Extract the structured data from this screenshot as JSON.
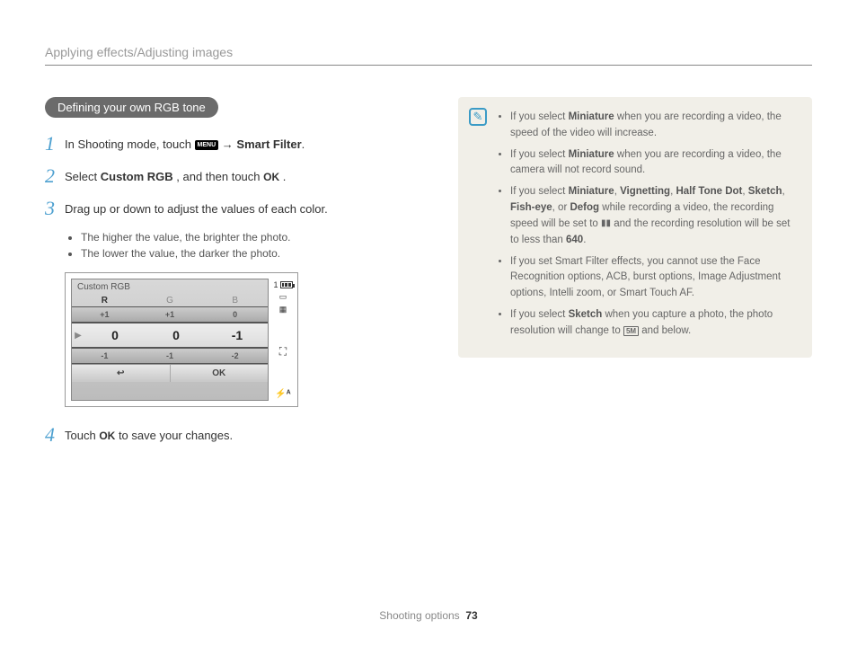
{
  "header": "Applying effects/Adjusting images",
  "pill": "Defining your own RGB tone",
  "steps": {
    "s1": {
      "num": "1",
      "pre": "In Shooting mode, touch ",
      "menu": "MENU",
      "arrow": " → ",
      "post": "Smart Filter",
      "end": "."
    },
    "s2": {
      "num": "2",
      "pre": "Select ",
      "cr": "Custom RGB",
      "mid": ", and then touch ",
      "ok": "OK",
      "end": " ."
    },
    "s3": {
      "num": "3",
      "text": "Drag up or down to adjust the values of each color."
    },
    "s3b": [
      "The higher the value, the brighter the photo.",
      "The lower the value, the darker the photo."
    ],
    "s4": {
      "num": "4",
      "pre": "Touch ",
      "ok": "OK",
      "post": " to save your changes."
    }
  },
  "rgb": {
    "title": "Custom RGB",
    "cols": [
      "R",
      "G",
      "B"
    ],
    "row_up": [
      "+1",
      "+1",
      "0"
    ],
    "row_mid": [
      "0",
      "0",
      "-1"
    ],
    "row_dn": [
      "-1",
      "-1",
      "-2"
    ],
    "back": "↩",
    "ok": "OK",
    "count": "1"
  },
  "notes": {
    "n1a": "If you select ",
    "n1b": "Miniature",
    "n1c": " when you are recording a video, the speed of the video will increase.",
    "n2a": "If you select ",
    "n2b": "Miniature",
    "n2c": " when you are recording a video, the camera will not record sound.",
    "n3a": "If you select ",
    "n3b": "Miniature",
    "n3c": ", ",
    "n3d": "Vignetting",
    "n3e": ", ",
    "n3f": "Half Tone Dot",
    "n3g": ", ",
    "n3h": "Sketch",
    "n3i": ", ",
    "n3j": "Fish-eye",
    "n3k": ", or ",
    "n3l": "Defog",
    "n3m": " while recording a video, the recording speed will be set to ",
    "n3n": " and the recording resolution will be set to less than ",
    "n3o": "640",
    "n3p": ".",
    "n4": "If you set Smart Filter effects, you cannot use the Face Recognition options, ACB, burst options, Image Adjustment options, Intelli zoom, or Smart Touch AF.",
    "n5a": "If you select ",
    "n5b": "Sketch",
    "n5c": " when you capture a photo, the photo resolution will change to ",
    "n5d": "5M",
    "n5e": " and below."
  },
  "footer": {
    "label": "Shooting options",
    "page": "73"
  }
}
